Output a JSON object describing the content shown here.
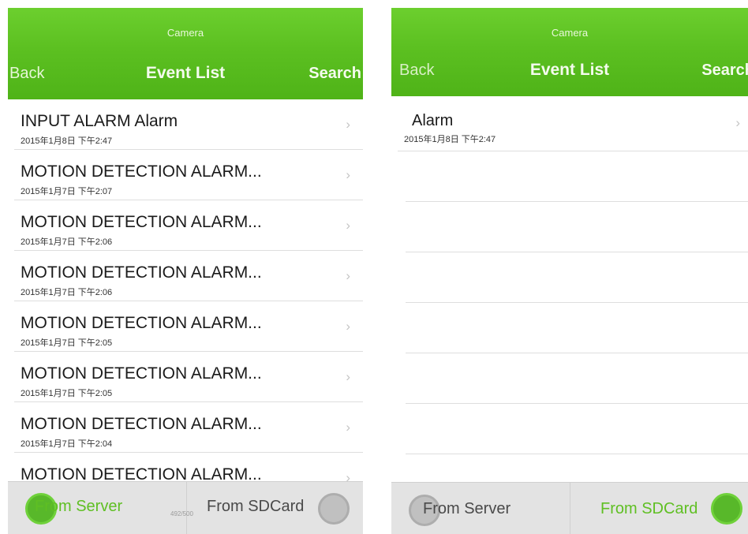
{
  "left_screen": {
    "header": {
      "camera": "Camera",
      "back": "Back",
      "title": "Event List",
      "search": "Search"
    },
    "rows": [
      {
        "title": "INPUT ALARM Alarm",
        "date": "2015年1月8日 下午2:47"
      },
      {
        "title": "MOTION DETECTION ALARM...",
        "date": "2015年1月7日 下午2:07"
      },
      {
        "title": "MOTION DETECTION ALARM...",
        "date": "2015年1月7日 下午2:06"
      },
      {
        "title": "MOTION DETECTION ALARM...",
        "date": "2015年1月7日 下午2:06"
      },
      {
        "title": "MOTION DETECTION ALARM...",
        "date": "2015年1月7日 下午2:05"
      },
      {
        "title": "MOTION DETECTION ALARM...",
        "date": "2015年1月7日 下午2:05"
      },
      {
        "title": "MOTION DETECTION ALARM...",
        "date": "2015年1月7日 下午2:04"
      },
      {
        "title": "MOTION DETECTION ALARM...",
        "date": ""
      }
    ],
    "chevron": "›",
    "footer": {
      "server_label": "From Server",
      "sdcard_label": "From SDCard",
      "counter": "492/500",
      "selected": "From Server"
    }
  },
  "right_screen": {
    "header": {
      "camera": "Camera",
      "back": "Back",
      "title": "Event List",
      "search": "Search"
    },
    "rows": [
      {
        "title": "Alarm",
        "date": "2015年1月8日 下午2:47"
      }
    ],
    "chevron": "›",
    "footer": {
      "server_label": "From Server",
      "sdcard_label": "From SDCard",
      "selected": "From SDCard"
    }
  },
  "colors": {
    "accent": "#5cc021",
    "header_dark": "#4fb318",
    "footer_bg": "#e3e3e3"
  }
}
